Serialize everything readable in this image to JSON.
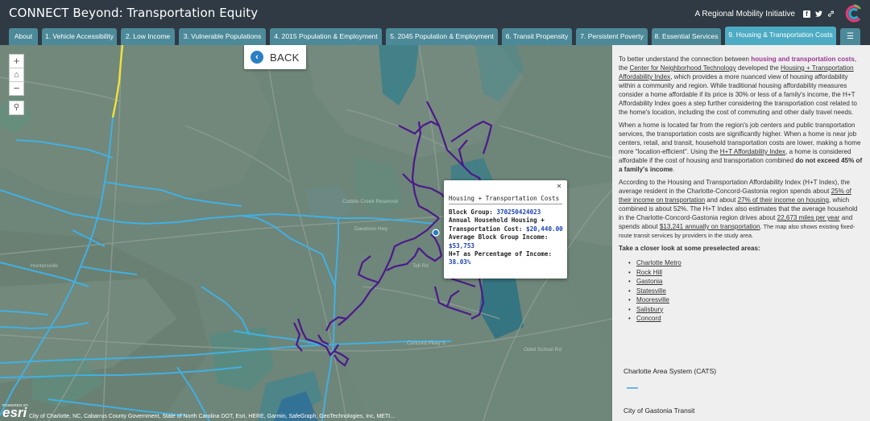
{
  "header": {
    "title": "CONNECT Beyond: Transportation Equity",
    "subtitle": "A Regional Mobility Initiative",
    "social_icons": [
      "facebook-icon",
      "twitter-icon",
      "link-icon"
    ],
    "colors": {
      "header_bg": "#2f3a44",
      "tab": "#4d8a99",
      "tab_active": "#4dacc4"
    }
  },
  "tabs": [
    {
      "label": "About",
      "active": false
    },
    {
      "label": "1. Vehicle Accessibility",
      "active": false
    },
    {
      "label": "2. Low Income",
      "active": false
    },
    {
      "label": "3. Vulnerable Populations",
      "active": false
    },
    {
      "label": "4. 2015 Population & Employment",
      "active": false
    },
    {
      "label": "5. 2045 Population & Employment",
      "active": false
    },
    {
      "label": "6. Transit Propensity",
      "active": false
    },
    {
      "label": "7. Persistent Poverty",
      "active": false
    },
    {
      "label": "8. Essential Services",
      "active": false
    },
    {
      "label": "9. Housing & Transportation Costs",
      "active": true
    }
  ],
  "map": {
    "zoom_in": "+",
    "home_icon": "⌂",
    "zoom_out": "−",
    "search_icon": "⚲",
    "back_label": "BACK",
    "places": [
      "Huntersville",
      "Davidson Hwy",
      "Coddle Creek Reservoir",
      "Concord Pkwy S",
      "Tell Rd",
      "Odell School Rd"
    ],
    "popup": {
      "title": "Housing + Transportation Costs",
      "block_group_label": "Block Group:",
      "block_group": "370250424023",
      "annual_cost_label": "Annual Household Housing + Transportation Cost:",
      "annual_cost": "$20,440.00",
      "avg_income_label": "Average Block Group Income:",
      "avg_income": "$53,753",
      "ht_pct_label": "H+T as Percentage of Income:",
      "ht_pct": "38.03%"
    },
    "attribution": "City of Charlotte, NC, Cabarrus County Government, State of North Carolina DOT, Esri, HERE, Garmin, SafeGraph, GeoTechnologies, Inc, METI...",
    "esri_powered": "POWERED BY",
    "esri_text": "esri"
  },
  "panel": {
    "p1_a": "To better understand the connection between ",
    "p1_hl": "housing and transportation costs",
    "p1_b": ", the ",
    "p1_link1": "Center for Neighborhood Technology",
    "p1_c": " developed the ",
    "p1_link2": "Housing + Transportation Affordability Index",
    "p1_d": ", which provides a more nuanced view of housing affordability within a community and region. While traditional housing affordability measures consider a home affordable if its price is 30% or less of a family's income, the H+T Affordability Index goes a step further considering the transportation cost related to the home's location, including the cost of commuting and other daily travel needs.",
    "p2_a": "When a home is located far from the region's job centers and public transportation services, the transportation costs are significantly higher. When a home is near job centers, retail, and transit, household transportation costs are lower, making a home more \"location-efficient\". Using the ",
    "p2_link": "H+T Affordability Index",
    "p2_b": ", a home is considered affordable if the cost of housing and transportation combined ",
    "p2_bold": "do not exceed 45% of a family's income",
    "p2_c": ".",
    "p3_a": "According to the Housing and Transportation Affordability Index (H+T Index), the average resident in the Charlotte-Concord-Gastonia region spends about ",
    "p3_link1": "25% of their income on transportation",
    "p3_b": " and about ",
    "p3_link2": "27% of their income on housing",
    "p3_c": ", which combined is about 52%. The H+T Index also estimates that the average household in the Charlotte-Concord-Gastonia region drives about ",
    "p3_link3": "22,673 miles per year",
    "p3_d": " and spends about ",
    "p3_link4": "$13,241 annually on transportation",
    "p3_e": ".",
    "p3_small": " The map also shows existing fixed-route transit services by providers in the study area.",
    "closer": "Take a closer look at some preselected areas:",
    "areas": [
      "Charlotte Metro",
      "Rock Hill",
      "Gastonia",
      "Statesville",
      "Mooresville",
      "Salisbury",
      "Concord"
    ],
    "legend": [
      {
        "label": "Charlotte Area System (CATS)",
        "color": "#6ab7e6"
      },
      {
        "label": "City of Gastonia Transit",
        "color": "#6ab7e6"
      }
    ]
  }
}
